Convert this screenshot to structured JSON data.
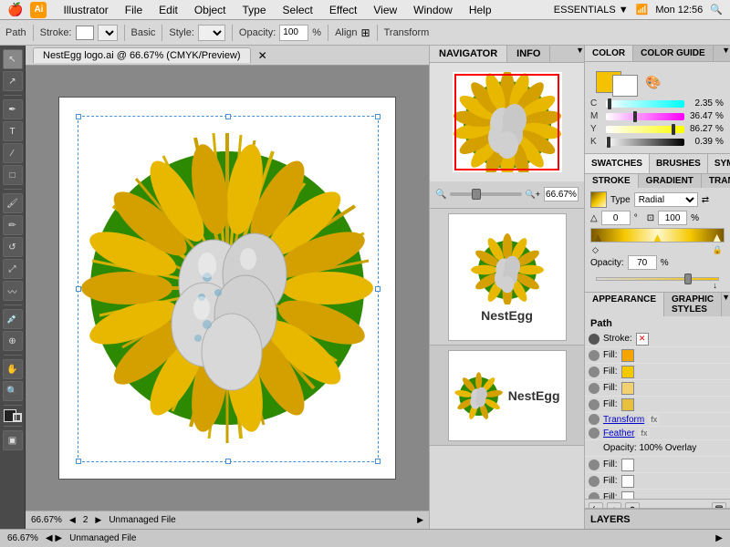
{
  "menubar": {
    "apple": "🍎",
    "app_name": "Illustrator",
    "items": [
      "File",
      "Edit",
      "Object",
      "Type",
      "Select",
      "Effect",
      "View",
      "Window",
      "Help"
    ],
    "right": {
      "essentials": "ESSENTIALS ▼",
      "time": "Mon 12:56"
    }
  },
  "toolbar": {
    "path_label": "Path",
    "stroke_label": "Stroke:",
    "stroke_value": "",
    "basic_label": "Basic",
    "style_label": "Style:",
    "opacity_label": "Opacity:",
    "opacity_value": "100",
    "align_label": "Align",
    "transform_label": "Transform"
  },
  "canvas": {
    "tab_name": "NestEgg logo.ai @ 66.67% (CMYK/Preview)",
    "zoom": "66.67%",
    "bottom_label": "Unmanaged File",
    "page_label": "2"
  },
  "navigator": {
    "tab1": "NAVIGATOR",
    "tab2": "INFO",
    "zoom_value": "66.67%"
  },
  "thumbnails": {
    "thumb2": {
      "label": "NestEgg"
    },
    "thumb3": {
      "label": "NestEgg"
    }
  },
  "color_panel": {
    "tab1": "COLOR",
    "tab2": "COLOR GUIDE",
    "sliders": [
      {
        "label": "C",
        "value": "2.35",
        "pct": "%",
        "pos": 3
      },
      {
        "label": "M",
        "value": "36.47",
        "pct": "%",
        "pos": 36
      },
      {
        "label": "Y",
        "value": "86.27",
        "pct": "%",
        "pos": 86
      },
      {
        "label": "K",
        "value": "0.39",
        "pct": "%",
        "pos": 1
      }
    ],
    "swatch_color": "#f5c200"
  },
  "swatches": {
    "tab1": "SWATCHES",
    "tab2": "BRUSHES",
    "tab3": "SYMBOLS"
  },
  "stroke_panel": {
    "tab1": "STROKE",
    "tab2": "GRADIENT",
    "tab3": "TRANSPARE",
    "type_label": "Type",
    "type_value": "Radial",
    "angle_label": "△",
    "angle_value": "0",
    "scale_value": "100",
    "opacity_label": "Opacity:",
    "opacity_value": "70"
  },
  "appearance": {
    "tab1": "APPEARANCE",
    "tab2": "GRAPHIC STYLES",
    "title": "Path",
    "rows": [
      {
        "type": "stroke",
        "label": "Stroke:",
        "has_x": true,
        "swatch": "none"
      },
      {
        "type": "fill",
        "label": "Fill:",
        "swatch": "#f5a500"
      },
      {
        "type": "fill",
        "label": "Fill:",
        "swatch": "#f5c800"
      },
      {
        "type": "fill",
        "label": "Fill:",
        "swatch": "#f0d070"
      },
      {
        "type": "transform",
        "label": "Transform",
        "fx": true
      },
      {
        "type": "feather",
        "label": "Feather",
        "fx": true
      },
      {
        "type": "opacity",
        "label": "Opacity: 100% Overlay"
      },
      {
        "type": "fill2",
        "label": "Fill:",
        "swatch": "white"
      },
      {
        "type": "fill3",
        "label": "Fill:",
        "swatch": "white"
      },
      {
        "type": "fill4",
        "label": "Fill:",
        "swatch": "white"
      }
    ],
    "bottom_icons": [
      "fx",
      "+",
      "trash"
    ]
  },
  "layers": {
    "label": "LAYERS"
  },
  "tools": [
    "arrow",
    "direct-select",
    "pen",
    "text",
    "line",
    "rect",
    "scale",
    "warp",
    "eyedropper",
    "blend",
    "symbol-sprayer",
    "column-graph",
    "slice",
    "hand",
    "zoom",
    "fill-stroke",
    "screen-mode",
    "extra1",
    "extra2"
  ]
}
